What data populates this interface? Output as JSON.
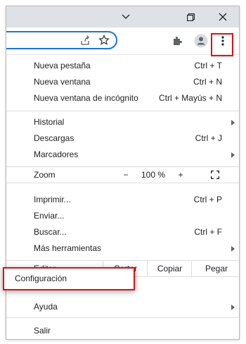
{
  "window": {
    "controls": [
      "chevron-down-icon",
      "restore-icon",
      "close-icon"
    ]
  },
  "toolbar": {
    "icons": [
      "share-icon",
      "bookmark-star-icon",
      "extensions-icon",
      "profile-icon",
      "kebab-menu-icon"
    ]
  },
  "menu": {
    "new_tab": {
      "label": "Nueva pestaña",
      "shortcut": "Ctrl + T"
    },
    "new_window": {
      "label": "Nueva ventana",
      "shortcut": "Ctrl + N"
    },
    "incognito": {
      "label": "Nueva ventana de incógnito",
      "shortcut": "Ctrl + Mayús + N"
    },
    "history": {
      "label": "Historial"
    },
    "downloads": {
      "label": "Descargas",
      "shortcut": "Ctrl + J"
    },
    "bookmarks": {
      "label": "Marcadores"
    },
    "zoom": {
      "label": "Zoom",
      "minus": "−",
      "value": "100 %",
      "plus": "+"
    },
    "print": {
      "label": "Imprimir...",
      "shortcut": "Ctrl + P"
    },
    "cast": {
      "label": "Enviar..."
    },
    "find": {
      "label": "Buscar...",
      "shortcut": "Ctrl + F"
    },
    "more_tools": {
      "label": "Más herramientas"
    },
    "edit": {
      "label": "Editar",
      "cut": "Cortar",
      "copy": "Copiar",
      "paste": "Pegar"
    },
    "settings": {
      "label": "Configuración"
    },
    "help": {
      "label": "Ayuda"
    },
    "exit": {
      "label": "Salir"
    }
  },
  "colors": {
    "highlight": "#e01010",
    "omnibox_border": "#1a73e8",
    "titlebar": "#dee1e6"
  }
}
